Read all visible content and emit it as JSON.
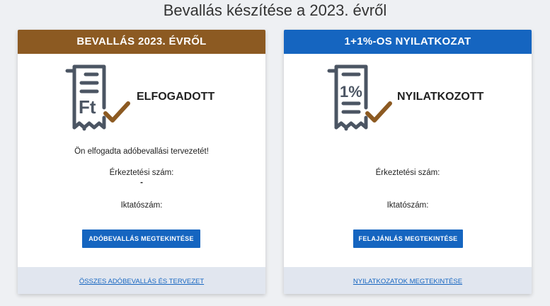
{
  "page": {
    "title": "Bevallás készítése a 2023. évről"
  },
  "cards": {
    "tax": {
      "header": "BEVALLÁS 2023. ÉVRŐL",
      "icon": "tax-document-check-icon",
      "icon_glyph": "Ft",
      "status": "ELFOGADOTT",
      "message": "Ön elfogadta adóbevallási tervezetét!",
      "registration_label": "Érkeztetési szám:",
      "registration_value": "-",
      "filing_label": "Iktatószám:",
      "button_label": "ADÓBEVALLÁS MEGTEKINTÉSE",
      "footer_link": "ÖSSZES ADÓBEVALLÁS ÉS TERVEZET",
      "accent": "#8c5a22"
    },
    "donation": {
      "header": "1+1%-OS NYILATKOZAT",
      "icon": "percent-document-check-icon",
      "icon_glyph": "1%",
      "status": "NYILATKOZOTT",
      "registration_label": "Érkeztetési szám:",
      "filing_label": "Iktatószám:",
      "button_label": "FELAJÁNLÁS MEGTEKINTÉSE",
      "footer_link": "NYILATKOZATOK MEGTEKINTÉSE",
      "accent": "#1565c0"
    }
  },
  "colors": {
    "check": "#8c5a22",
    "icon": "#4b5563",
    "button": "#1565c0"
  }
}
